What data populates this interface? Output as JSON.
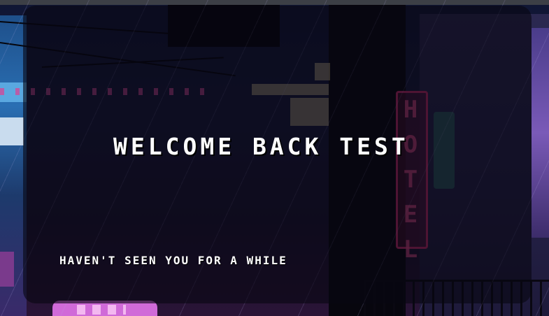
{
  "welcome": {
    "title": "WELCOME BACK TEST",
    "subtitle": "HAVEN'T SEEN YOU FOR A WHILE"
  },
  "background": {
    "description_icon": "pixel-city-rain-background",
    "hotel_sign_text": "HOTEL",
    "colors": {
      "sky": "#101634",
      "neon_pink": "#d04a9a",
      "neon_blue": "#2a6fb3",
      "card_overlay": "#080612"
    }
  }
}
